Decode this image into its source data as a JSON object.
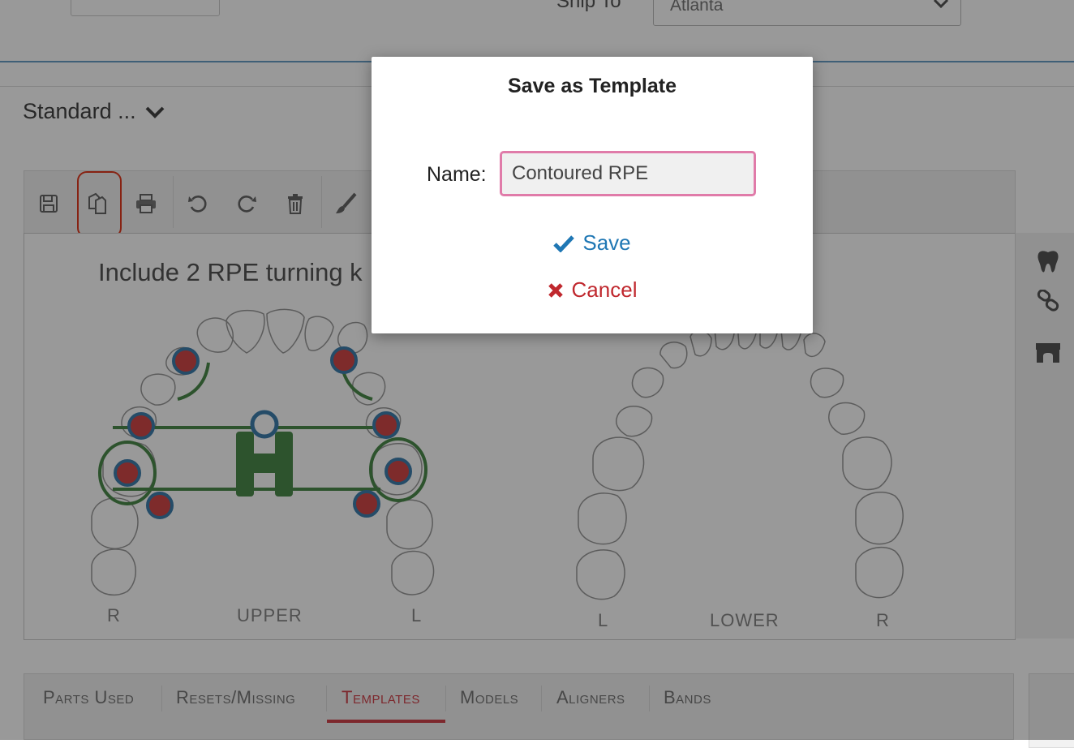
{
  "header": {
    "ship_to_label": "Ship To",
    "ship_to_value": "Atlanta",
    "standard_label": "Standard ..."
  },
  "editor": {
    "toolbar_icons": [
      "save-icon",
      "copy-icon",
      "print-icon",
      "undo-icon",
      "redo-icon",
      "trash-icon",
      "brush-icon"
    ],
    "note_text": "Include 2 RPE turning k",
    "upper": {
      "left": "R",
      "center": "UPPER",
      "right": "L"
    },
    "lower": {
      "left": "L",
      "center": "LOWER",
      "right": "R"
    },
    "side_icons": [
      "tooth-icon",
      "link-icon",
      "bridge-icon"
    ]
  },
  "tabs": [
    {
      "label": "Parts Used",
      "active": false
    },
    {
      "label": "Resets/Missing",
      "active": false
    },
    {
      "label": "Templates",
      "active": true
    },
    {
      "label": "Models",
      "active": false
    },
    {
      "label": "Aligners",
      "active": false
    },
    {
      "label": "Bands",
      "active": false
    }
  ],
  "modal": {
    "title": "Save as Template",
    "name_label": "Name:",
    "name_value": "Contoured RPE",
    "save_label": "Save",
    "cancel_label": "Cancel"
  },
  "colors": {
    "accent_blue": "#1f77b4",
    "cancel_red": "#c0282e",
    "active_tab": "#d0434c",
    "input_border": "#e07ba9",
    "highlight": "#e23a1f",
    "appliance_green": "#4c8a4c"
  }
}
